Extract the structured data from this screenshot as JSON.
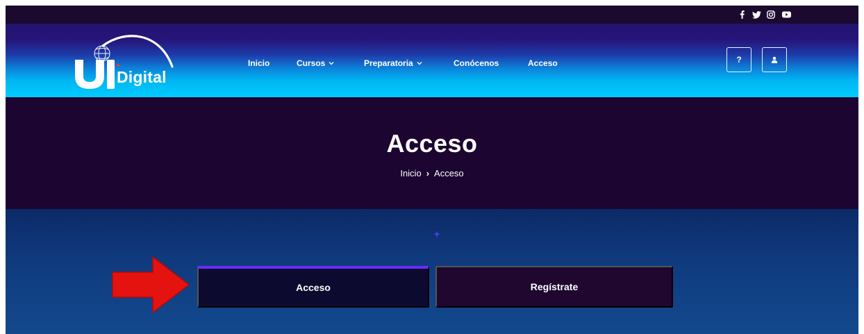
{
  "social": {
    "facebook_icon": "facebook-icon",
    "twitter_icon": "twitter-icon",
    "instagram_icon": "instagram-icon",
    "youtube_icon": "youtube-icon"
  },
  "header": {
    "logo_text": "Digital",
    "nav": [
      {
        "label": "Inicio"
      },
      {
        "label": "Cursos"
      },
      {
        "label": "Preparatoria"
      },
      {
        "label": "Conócenos"
      },
      {
        "label": "Acceso"
      }
    ],
    "help_label": "?",
    "user_icon": "user-icon"
  },
  "banner": {
    "title": "Acceso",
    "breadcrumb": {
      "home": "Inicio",
      "separator": "›",
      "current": "Acceso"
    }
  },
  "content": {
    "plus": "+",
    "tabs": {
      "login": "Acceso",
      "register": "Regístrate"
    }
  },
  "colors": {
    "topbar": "#1b0a2e",
    "banner": "#1c0530",
    "accent": "#6b2bff",
    "arrow": "#e5130f"
  }
}
